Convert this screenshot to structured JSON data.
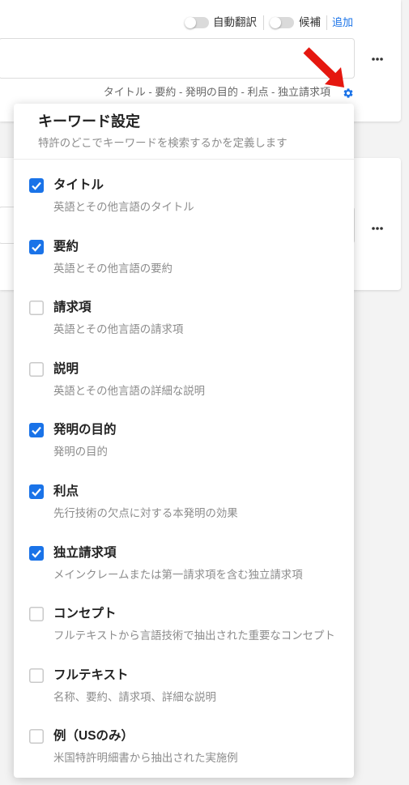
{
  "colors": {
    "accent": "#1a73e8",
    "annotation_arrow": "#e5170f",
    "checkbox_checked": "#1a73e8"
  },
  "search_card": {
    "toggles": [
      {
        "label": "自動翻訳",
        "on": false
      },
      {
        "label": "候補",
        "on": false
      }
    ],
    "add_link": "追加",
    "fields_summary": "タイトル - 要約 - 発明の目的 - 利点 - 独立請求項",
    "settings_icon": "gear-icon",
    "more_icon": "more-horizontal-icon"
  },
  "second_card": {
    "more_icon": "more-horizontal-icon"
  },
  "keyword_settings": {
    "title": "キーワード設定",
    "subtitle": "特許のどこでキーワードを検索するかを定義します",
    "options": [
      {
        "label": "タイトル",
        "description": "英語とその他言語のタイトル",
        "checked": true
      },
      {
        "label": "要約",
        "description": "英語とその他言語の要約",
        "checked": true
      },
      {
        "label": "請求項",
        "description": "英語とその他言語の請求項",
        "checked": false
      },
      {
        "label": "説明",
        "description": "英語とその他言語の詳細な説明",
        "checked": false
      },
      {
        "label": "発明の目的",
        "description": "発明の目的",
        "checked": true
      },
      {
        "label": "利点",
        "description": "先行技術の欠点に対する本発明の効果",
        "checked": true
      },
      {
        "label": "独立請求項",
        "description": "メインクレームまたは第一請求項を含む独立請求項",
        "checked": true
      },
      {
        "label": "コンセプト",
        "description": "フルテキストから言語技術で抽出された重要なコンセプト",
        "checked": false
      },
      {
        "label": "フルテキスト",
        "description": "名称、要約、請求項、詳細な説明",
        "checked": false
      },
      {
        "label": "例（USのみ）",
        "description": "米国特許明細書から抽出された実施例",
        "checked": false
      }
    ]
  }
}
